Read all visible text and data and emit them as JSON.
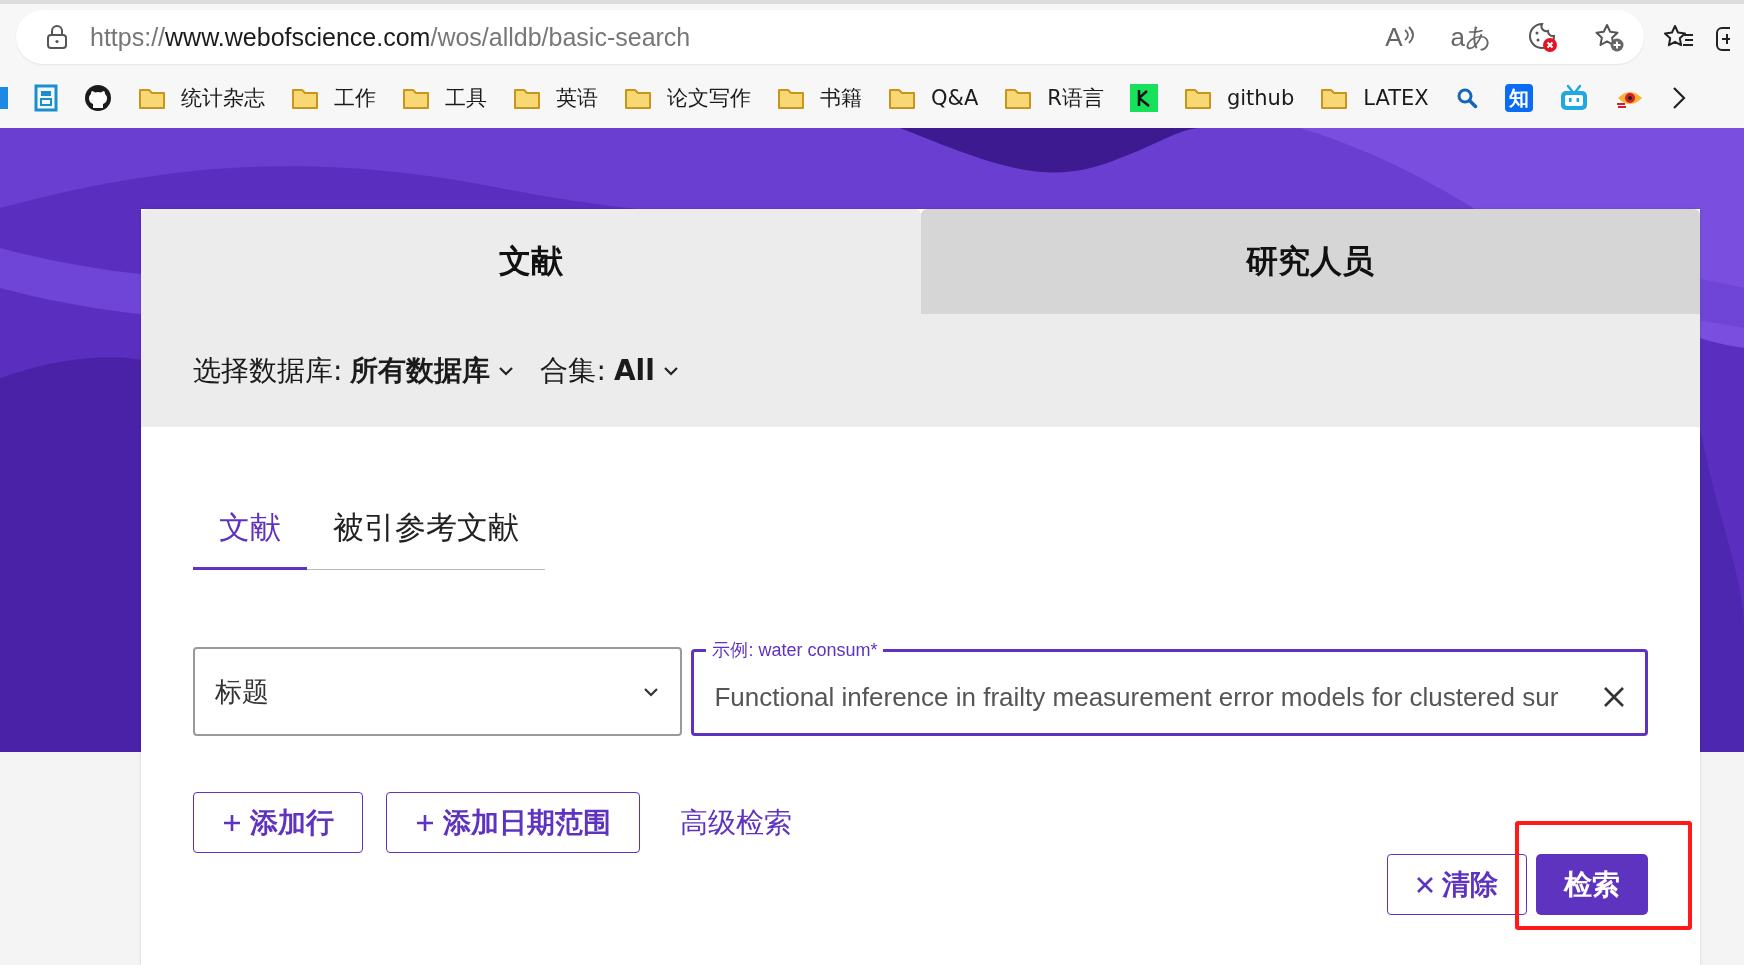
{
  "browser": {
    "url_scheme": "https://",
    "url_host": "www.webofscience.com",
    "url_path": "/wos/alldb/basic-search",
    "translate_glyph": "aあ",
    "read_aloud_glyph": "A"
  },
  "bookmarks": [
    {
      "kind": "site"
    },
    {
      "kind": "site"
    },
    {
      "kind": "site"
    },
    {
      "kind": "folder",
      "label": "统计杂志"
    },
    {
      "kind": "folder",
      "label": "工作"
    },
    {
      "kind": "folder",
      "label": "工具"
    },
    {
      "kind": "folder",
      "label": "英语"
    },
    {
      "kind": "folder",
      "label": "论文写作"
    },
    {
      "kind": "folder",
      "label": "书籍"
    },
    {
      "kind": "folder",
      "label": "Q&A"
    },
    {
      "kind": "folder",
      "label": "R语言"
    },
    {
      "kind": "site"
    },
    {
      "kind": "folder",
      "label": "github"
    },
    {
      "kind": "folder",
      "label": "LATEX"
    },
    {
      "kind": "site"
    },
    {
      "kind": "site",
      "glyph": "知"
    },
    {
      "kind": "site"
    },
    {
      "kind": "site"
    }
  ],
  "main_tabs": [
    {
      "label": "文献",
      "selected": true
    },
    {
      "label": "研究人员",
      "selected": false
    }
  ],
  "database": {
    "label": "选择数据库:",
    "value": "所有数据库"
  },
  "collection": {
    "label": "合集:",
    "value": "All"
  },
  "sub_tabs": [
    {
      "label": "文献",
      "selected": true
    },
    {
      "label": "被引参考文献",
      "selected": false
    }
  ],
  "search_row": {
    "field": "标题",
    "query_label": "示例: water consum*",
    "query": "Functional inference in frailty measurement error models for clustered sur"
  },
  "actions": [
    {
      "kind": "outline",
      "label": "添加行"
    },
    {
      "kind": "outline",
      "label": "添加日期范围"
    },
    {
      "kind": "link",
      "label": "高级检索"
    }
  ],
  "footer_buttons": [
    {
      "kind": "outline",
      "label": "清除",
      "highlighted": false
    },
    {
      "kind": "primary",
      "label": "检索",
      "highlighted": true
    }
  ]
}
